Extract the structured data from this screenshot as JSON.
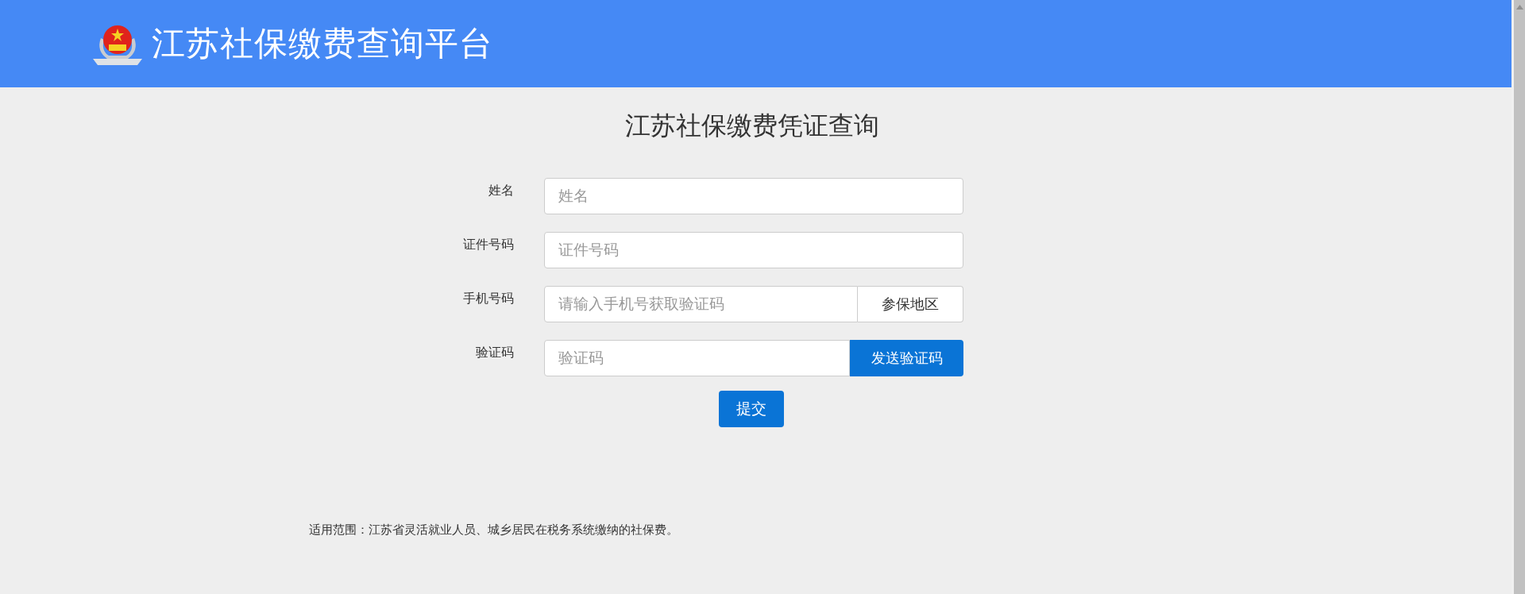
{
  "header": {
    "title": "江苏社保缴费查询平台"
  },
  "page_title": "江苏社保缴费凭证查询",
  "form": {
    "fields": [
      {
        "kind": "text",
        "label": "姓名",
        "placeholder": "姓名"
      },
      {
        "kind": "text",
        "label": "证件号码",
        "placeholder": "证件号码"
      },
      {
        "kind": "addon",
        "label": "手机号码",
        "placeholder": "请输入手机号获取验证码",
        "addon": "参保地区"
      },
      {
        "kind": "button",
        "label": "验证码",
        "placeholder": "验证码",
        "button": "发送验证码"
      }
    ],
    "submit": "提交"
  },
  "note": "适用范围：江苏省灵活就业人员、城乡居民在税务系统缴纳的社保费。"
}
